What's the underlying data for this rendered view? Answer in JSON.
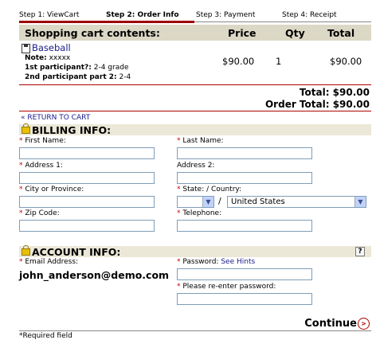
{
  "steps": [
    {
      "label": "Step 1: ViewCart",
      "active": false
    },
    {
      "label": "Step 2: Order Info",
      "active": true
    },
    {
      "label": "Step 3: Payment",
      "active": false
    },
    {
      "label": "Step 4: Receipt",
      "active": false
    }
  ],
  "cart": {
    "title": "Shopping cart contents:",
    "col_price": "Price",
    "col_qty": "Qty",
    "col_total": "Total",
    "item": {
      "name": "Baseball",
      "note_label": "Note:",
      "note_value": "xxxxx",
      "p1_label": "1st participant?:",
      "p1_value": "2-4 grade",
      "p2_label": "2nd participant part 2:",
      "p2_value": "2-4",
      "price": "$90.00",
      "qty": "1",
      "total": "$90.00"
    },
    "total_line": "Total: $90.00",
    "order_total_line": "Order Total: $90.00",
    "return_link": "« RETURN TO CART"
  },
  "billing": {
    "title": "BILLING INFO:",
    "first_name": "First Name:",
    "last_name": "Last Name:",
    "address1": "Address 1:",
    "address2": "Address 2:",
    "city": "City or Province:",
    "state_country": "State: / Country:",
    "country_value": "United States",
    "slash": "/",
    "zip": "Zip Code:",
    "telephone": "Telephone:"
  },
  "account": {
    "title": "ACCOUNT INFO:",
    "help": "?",
    "email_label": "Email Address:",
    "email_value": "john_anderson@demo.com",
    "password_label": "Password:",
    "see_hints": "See Hints",
    "reenter_label": "Please re-enter password:"
  },
  "footer": {
    "continue": "Continue",
    "required_note": "*Required field",
    "asterisk": "*"
  },
  "colors": {
    "accent_red": "#a00000",
    "header_bg": "#dcd8c6",
    "link": "#1a1a8c"
  }
}
